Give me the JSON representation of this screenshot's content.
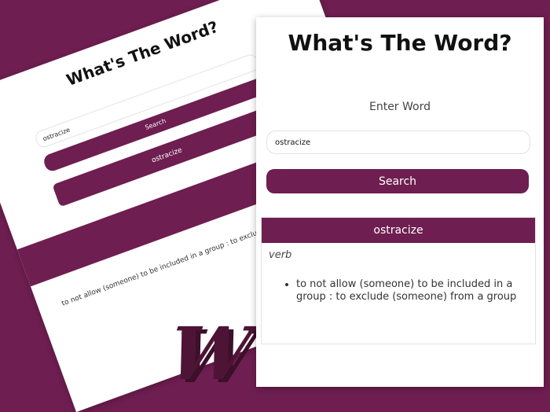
{
  "app": {
    "title": "What's The Word?"
  },
  "search": {
    "label": "Enter Word",
    "value": "ostracize",
    "button_label": "Search"
  },
  "result": {
    "word": "ostracize",
    "part_of_speech": "verb",
    "definitions": [
      "to not allow (someone) to be included in a group : to exclude (someone) from a group"
    ]
  },
  "background_preview": {
    "title": "What's The Word?",
    "input_value": "ostracize",
    "button_label": "Search",
    "word": "ostracize",
    "definition": "to not allow (someone) to be included in a group : to exclude (someone) from a group"
  },
  "logo": {
    "letter": "W"
  },
  "colors": {
    "brand": "#6e1e50",
    "background": "#6e1e50",
    "card": "#ffffff"
  }
}
